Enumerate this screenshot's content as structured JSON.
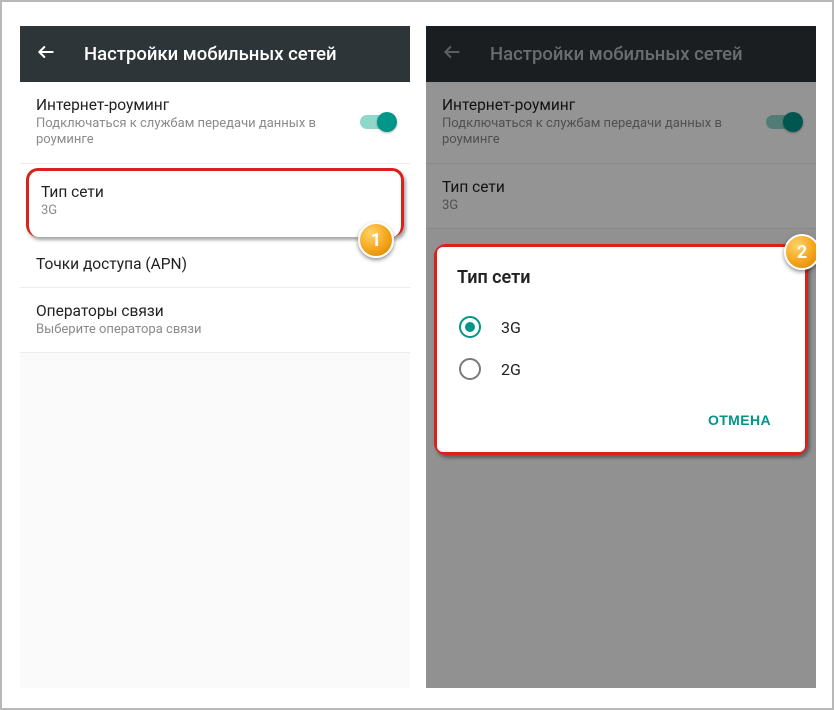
{
  "appbar": {
    "title": "Настройки мобильных сетей"
  },
  "rows": {
    "roaming": {
      "title": "Интернет-роуминг",
      "sub": "Подключаться к службам передачи данных в роуминге"
    },
    "nettype": {
      "title": "Тип сети",
      "sub": "3G"
    },
    "apn": {
      "title": "Точки доступа (APN)"
    },
    "operators": {
      "title": "Операторы связи",
      "sub": "Выберите оператора связи"
    }
  },
  "dialog": {
    "title": "Тип сети",
    "options": {
      "opt1": "3G",
      "opt2": "2G"
    },
    "cancel": "ОТМЕНА"
  },
  "markers": {
    "m1": "1",
    "m2": "2"
  }
}
